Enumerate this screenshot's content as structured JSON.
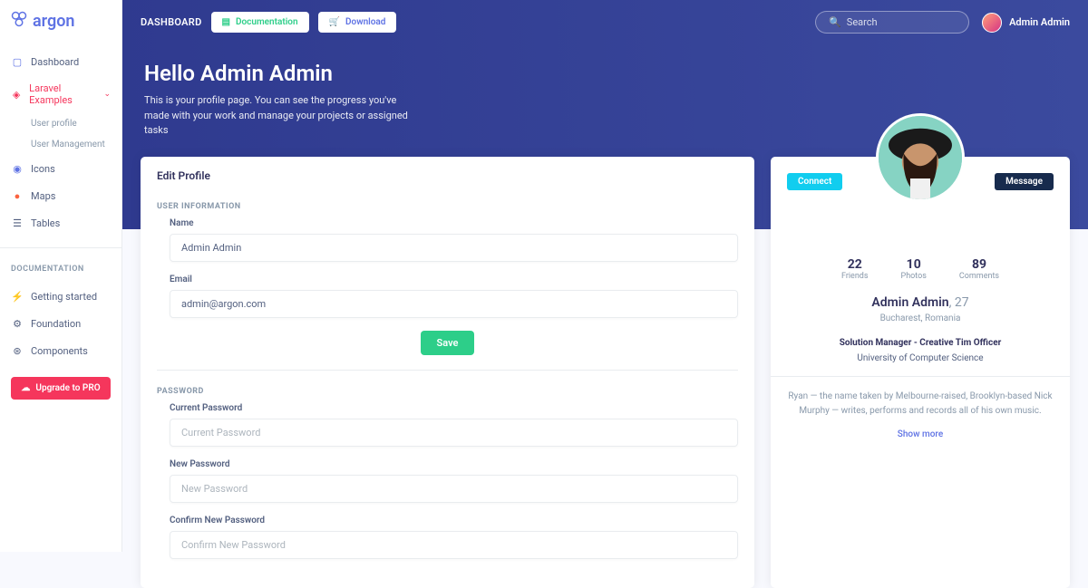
{
  "brand": "argon",
  "topnav": {
    "dashboard": "DASHBOARD",
    "doc_btn": "Documentation",
    "download_btn": "Download",
    "search_placeholder": "Search",
    "user_name": "Admin Admin"
  },
  "hero": {
    "title": "Hello Admin Admin",
    "subtitle": "This is your profile page. You can see the progress you've made with your work and manage your projects or assigned tasks"
  },
  "sidebar": {
    "items": [
      {
        "label": "Dashboard"
      },
      {
        "label": "Laravel Examples"
      },
      {
        "label": "Icons"
      },
      {
        "label": "Maps"
      },
      {
        "label": "Tables"
      }
    ],
    "sub": [
      {
        "label": "User profile"
      },
      {
        "label": "User Management"
      }
    ],
    "doc_heading": "DOCUMENTATION",
    "docs": [
      {
        "label": "Getting started"
      },
      {
        "label": "Foundation"
      },
      {
        "label": "Components"
      }
    ],
    "upgrade": "Upgrade to PRO"
  },
  "edit": {
    "title": "Edit Profile",
    "user_info_heading": "USER INFORMATION",
    "name_label": "Name",
    "name_value": "Admin Admin",
    "email_label": "Email",
    "email_value": "admin@argon.com",
    "save": "Save",
    "password_heading": "PASSWORD",
    "current_pw_label": "Current Password",
    "current_pw_placeholder": "Current Password",
    "new_pw_label": "New Password",
    "new_pw_placeholder": "New Password",
    "confirm_pw_label": "Confirm New Password",
    "confirm_pw_placeholder": "Confirm New Password"
  },
  "profile": {
    "connect": "Connect",
    "message": "Message",
    "stats": [
      {
        "value": "22",
        "label": "Friends"
      },
      {
        "value": "10",
        "label": "Photos"
      },
      {
        "value": "89",
        "label": "Comments"
      }
    ],
    "name": "Admin Admin",
    "age": ", 27",
    "location": "Bucharest, Romania",
    "role": "Solution Manager - Creative Tim Officer",
    "education": "University of Computer Science",
    "bio": "Ryan — the name taken by Melbourne-raised, Brooklyn-based Nick Murphy — writes, performs and records all of his own music.",
    "show_more": "Show more"
  }
}
